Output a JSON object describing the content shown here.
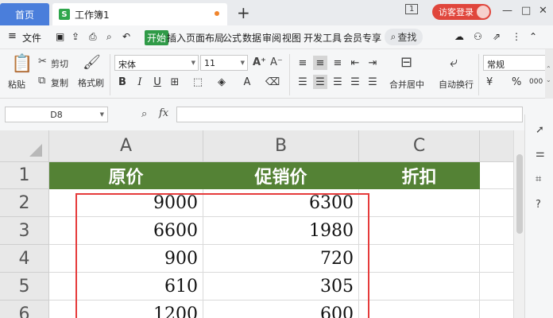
{
  "tabs": {
    "home_label": "首页",
    "doc_icon_letter": "S",
    "doc_label": "工作簿1",
    "new_tab_symbol": "+",
    "login_label": "访客登录"
  },
  "window_controls": {
    "pin": "1",
    "minimize": "—",
    "restore": "□",
    "close": "✕"
  },
  "menu": {
    "file": "文件",
    "items": [
      "开始",
      "插入",
      "页面布局",
      "公式",
      "数据",
      "审阅",
      "视图",
      "开发工具",
      "会员专享"
    ],
    "active_index": 0,
    "search_label": "查找"
  },
  "ribbon": {
    "cut": "剪切",
    "paste": "粘贴",
    "copy": "复制",
    "format_painter": "格式刷",
    "font_name": "宋体",
    "font_size": "11",
    "bold": "B",
    "italic": "I",
    "underline": "U",
    "merge_center": "合并居中",
    "auto_wrap": "自动换行",
    "number_format": "常规",
    "currency": "¥",
    "percent": "%",
    "thousands": "000"
  },
  "formula_bar": {
    "cell_ref": "D8",
    "fx": "fx",
    "formula": ""
  },
  "sheet": {
    "columns": [
      "A",
      "B",
      "C"
    ],
    "rows": [
      "1",
      "2",
      "3",
      "4",
      "5",
      "6"
    ],
    "header_row": [
      "原价",
      "促销价",
      "折扣"
    ],
    "data": [
      [
        "9000",
        "6300",
        ""
      ],
      [
        "6600",
        "1980",
        ""
      ],
      [
        "900",
        "720",
        ""
      ],
      [
        "610",
        "305",
        ""
      ],
      [
        "1200",
        "600",
        ""
      ]
    ],
    "header_fill": "#548235",
    "highlight_color": "#e53b3b"
  }
}
